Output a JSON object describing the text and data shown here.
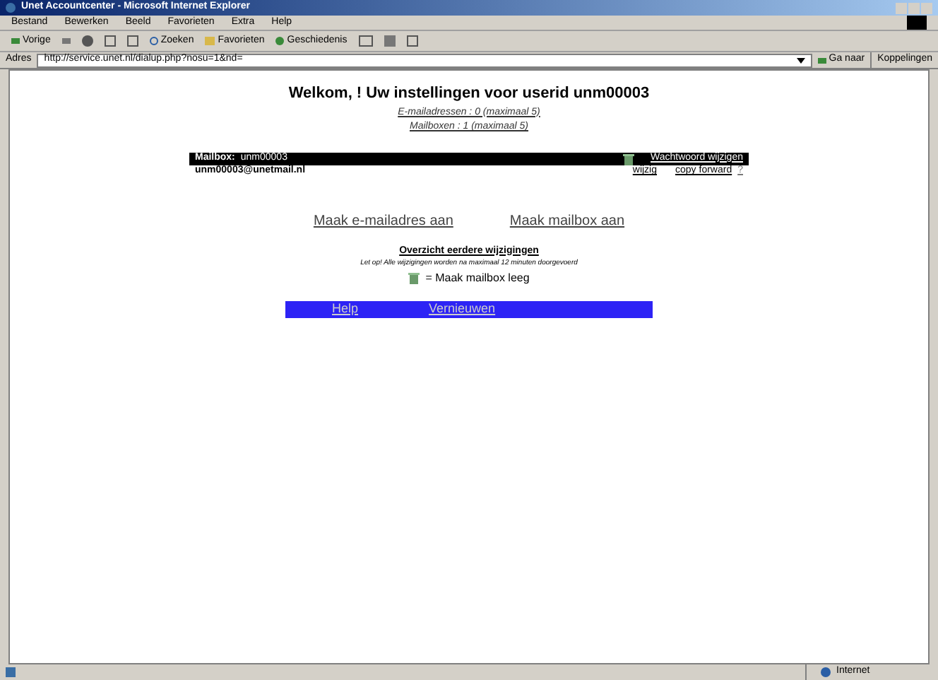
{
  "window": {
    "title": "Unet Accountcenter - Microsoft Internet Explorer"
  },
  "menu": [
    "Bestand",
    "Bewerken",
    "Beeld",
    "Favorieten",
    "Extra",
    "Help"
  ],
  "toolbar": {
    "back": "Vorige",
    "search": "Zoeken",
    "favorites": "Favorieten",
    "history": "Geschiedenis"
  },
  "address": {
    "label": "Adres",
    "value": "http://service.unet.nl/dialup.php?nosu=1&nd=",
    "go": "Ga naar",
    "links": "Koppelingen"
  },
  "page": {
    "heading": "Welkom, ! Uw instellingen voor userid unm00003",
    "counts": [
      "E-mailadressen : 0 (maximaal 5)",
      "Mailboxen : 1 (maximaal 5)"
    ],
    "mailbox": {
      "label": "Mailbox:",
      "name": "unm00003",
      "password_link": "Wachtwoord wijzigen",
      "address": "unm00003@unetmail.nl",
      "edit": "wijzig",
      "copy_forward": "copy forward",
      "help_mark": "?"
    },
    "actions": [
      "Maak e-mailadres aan",
      "Maak mailbox aan"
    ],
    "history_link": "Overzicht eerdere wijzigingen",
    "notice": "Let op! Alle wijzigingen worden na maximaal 12 minuten doorgevoerd",
    "legend": "= Maak mailbox leeg",
    "footer_links": [
      "Help",
      "Vernieuwen"
    ]
  },
  "status_bar": {
    "zone": "Internet"
  }
}
